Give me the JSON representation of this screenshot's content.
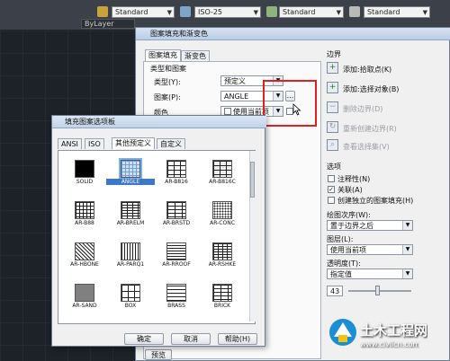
{
  "toolbar": {
    "items": [
      "",
      "",
      "",
      "",
      "",
      ""
    ],
    "style_combo": "Standard",
    "dim_combo": "ISO-25",
    "style2_combo": "Standard",
    "style3_combo": "Standard",
    "layer_combo": "ByLayer"
  },
  "hatch_dialog": {
    "title": "图案填充和渐变色",
    "tabs": [
      "图案填充",
      "渐变色"
    ],
    "type_group": "类型和图案",
    "type_label": "类型(Y):",
    "type_value": "预定义",
    "pattern_label": "图案(P):",
    "pattern_value": "ANGLE",
    "browse_label": "...",
    "color_label": "颜色",
    "color_value": "使用当前项",
    "boundary_title": "边界",
    "add_pick": "添加:拾取点(K)",
    "add_select": "添加:选择对象(B)",
    "remove_boundary": "删除边界(D)",
    "recreate_boundary": "重新创建边界(R)",
    "view_selection": "查看选择集(V)",
    "options_title": "选项",
    "annotative": "注释性(N)",
    "associative": "关联(A)",
    "separate": "创建独立的图案填充(H)",
    "draw_order_label": "绘图次序(W):",
    "draw_order_value": "置于边界之后",
    "layer_label": "图层(L):",
    "layer_value": "使用当前项",
    "transparency_label": "透明度(T):",
    "transparency_value": "指定值",
    "transparency_num": "43",
    "transparency_slider": 0.43,
    "preview_button": "预览"
  },
  "palette": {
    "title": "填充图案选项板",
    "tabs": [
      "ANSI",
      "ISO",
      "其他预定义",
      "自定义"
    ],
    "patterns": [
      "SOLID",
      "ANGLE",
      "AR-B816",
      "AR-B816C",
      "AR-B88",
      "AR-BRELM",
      "AR-BRSTD",
      "AR-CONC",
      "AR-HBONE",
      "AR-PARQ1",
      "AR-RROOF",
      "AR-RSHKE",
      "AR-SAND",
      "BOX",
      "BRASS",
      "BRICK"
    ],
    "selected": "ANGLE",
    "ok": "确定",
    "cancel": "取消",
    "help": "帮助(H)"
  },
  "watermark": {
    "brand": "土木工程网",
    "url": "www.civilcn.com"
  },
  "colors": {
    "accent": "#3b78c7",
    "highlight": "#e02020",
    "titlebar": "#c1d3ea"
  }
}
